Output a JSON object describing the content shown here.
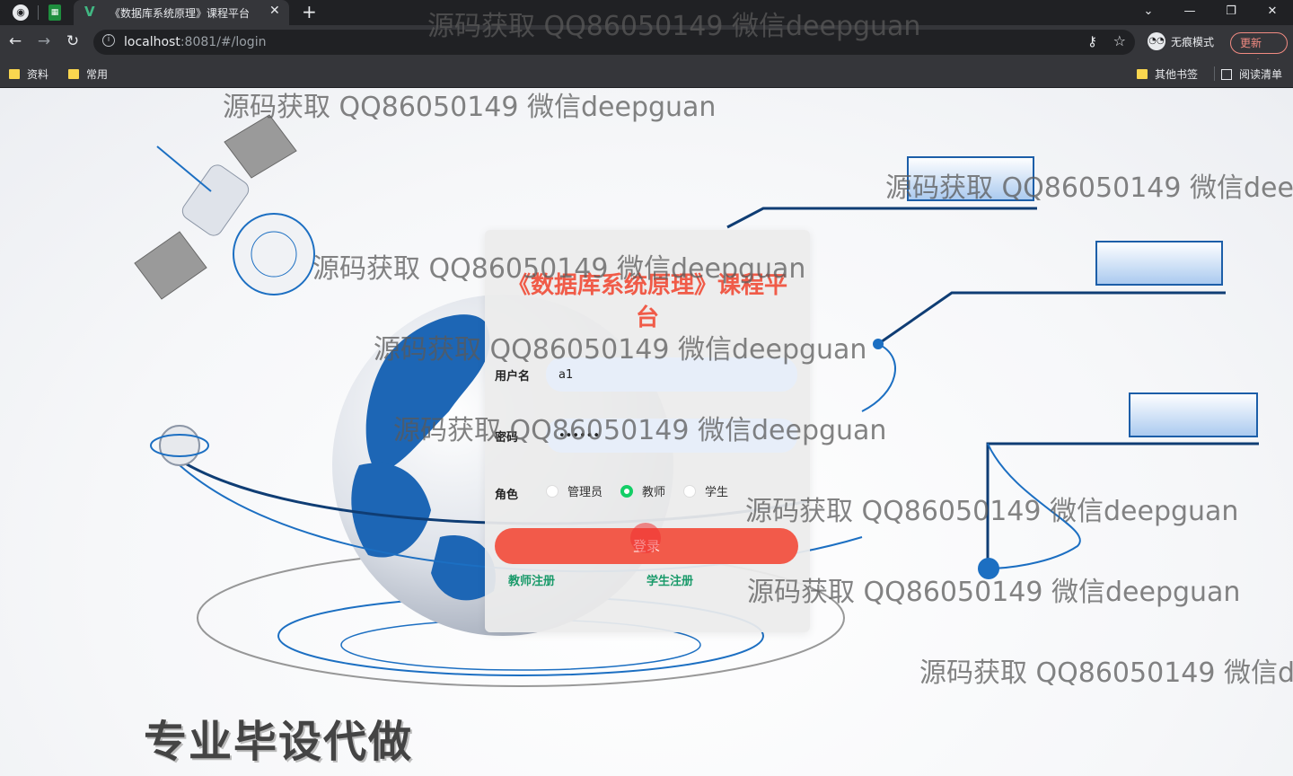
{
  "browser": {
    "tab_title": "《数据库系统原理》课程平台",
    "url_host": "localhost",
    "url_rest": ":8081/#/login",
    "incognito_label": "无痕模式",
    "update_label": "更新",
    "bookmarks": [
      "资料",
      "常用"
    ],
    "other_bookmarks": "其他书签",
    "reading_list": "阅读清单"
  },
  "login": {
    "title": "《数据库系统原理》课程平台",
    "username_label": "用户名",
    "username_value": "a1",
    "password_label": "密码",
    "password_value": "••••••",
    "role_label": "角色",
    "roles": [
      {
        "label": "管理员",
        "selected": false
      },
      {
        "label": "教师",
        "selected": true
      },
      {
        "label": "学生",
        "selected": false
      }
    ],
    "login_button": "登录",
    "teacher_register": "教师注册",
    "student_register": "学生注册"
  },
  "promo_text": "专业毕设代做",
  "watermark": "源码获取 QQ86050149 微信deepguan",
  "colors": {
    "accent": "#f25a4a",
    "radio_selected": "#13ce66",
    "link": "#1a9a6a"
  }
}
